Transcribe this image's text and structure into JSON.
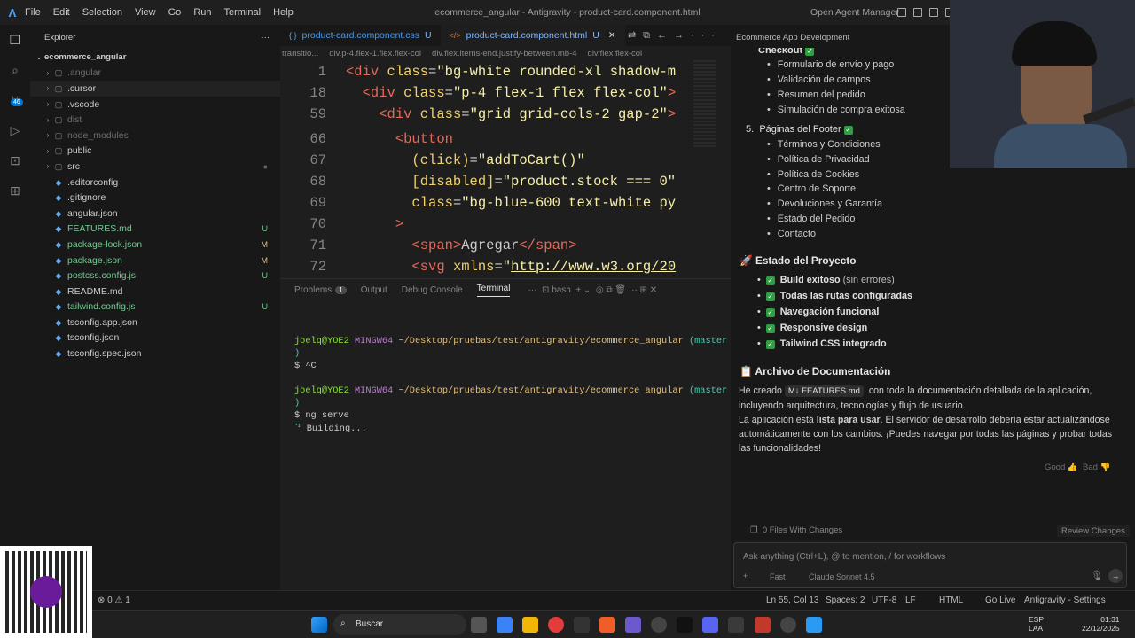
{
  "app": {
    "title": "ecommerce_angular - Antigravity - product-card.component.html",
    "agent_manager": "Open Agent Manager",
    "menu": [
      "File",
      "Edit",
      "Selection",
      "View",
      "Go",
      "Run",
      "Terminal",
      "Help"
    ]
  },
  "explorer": {
    "header": "Explorer",
    "project": "ecommerce_angular",
    "items": [
      {
        "name": ".angular",
        "type": "folder",
        "status": "",
        "tone": "dim"
      },
      {
        "name": ".cursor",
        "type": "folder",
        "status": "",
        "tone": "normal"
      },
      {
        "name": ".vscode",
        "type": "folder",
        "status": "",
        "tone": "normal"
      },
      {
        "name": "dist",
        "type": "folder",
        "status": "",
        "tone": "dim"
      },
      {
        "name": "node_modules",
        "type": "folder",
        "status": "",
        "tone": "dim"
      },
      {
        "name": "public",
        "type": "folder",
        "status": "",
        "tone": "normal"
      },
      {
        "name": "src",
        "type": "folder",
        "status": "●",
        "tone": "mod"
      },
      {
        "name": ".editorconfig",
        "type": "file",
        "status": "",
        "tone": "normal"
      },
      {
        "name": ".gitignore",
        "type": "file",
        "status": "",
        "tone": "normal"
      },
      {
        "name": "angular.json",
        "type": "file",
        "status": "",
        "tone": "normal"
      },
      {
        "name": "FEATURES.md",
        "type": "file",
        "status": "U",
        "tone": "git"
      },
      {
        "name": "package-lock.json",
        "type": "file",
        "status": "M",
        "tone": "git"
      },
      {
        "name": "package.json",
        "type": "file",
        "status": "M",
        "tone": "git"
      },
      {
        "name": "postcss.config.js",
        "type": "file",
        "status": "U",
        "tone": "git"
      },
      {
        "name": "README.md",
        "type": "file",
        "status": "",
        "tone": "normal"
      },
      {
        "name": "tailwind.config.js",
        "type": "file",
        "status": "U",
        "tone": "git"
      },
      {
        "name": "tsconfig.app.json",
        "type": "file",
        "status": "",
        "tone": "normal"
      },
      {
        "name": "tsconfig.json",
        "type": "file",
        "status": "",
        "tone": "normal"
      },
      {
        "name": "tsconfig.spec.json",
        "type": "file",
        "status": "",
        "tone": "normal"
      }
    ]
  },
  "activity_badge": "46",
  "editor": {
    "tabs": [
      {
        "label": "product-card.component.css",
        "status": "U"
      },
      {
        "label": "product-card.component.html",
        "status": "U",
        "active": true
      }
    ],
    "breadcrumbs": [
      "transitio...",
      "div.p-4.flex-1.flex.flex-col",
      "div.flex.items-end.justify-between.mb-4",
      "div.flex.flex-col"
    ],
    "lines": [
      {
        "n": "1",
        "html": "<span class='t-tag'>&lt;div</span> <span class='t-attr'>class</span>=<span class='t-str'>\"bg-white rounded-xl shadow-m</span>"
      },
      {
        "n": "18",
        "html": "  <span class='t-tag'>&lt;div</span> <span class='t-attr'>class</span>=<span class='t-str'>\"p-4 flex-1 flex flex-col\"</span><span class='t-tag'>&gt;</span>"
      },
      {
        "n": "59",
        "html": "    <span class='t-tag'>&lt;div</span> <span class='t-attr'>class</span>=<span class='t-str'>\"grid grid-cols-2 gap-2\"</span><span class='t-tag'>&gt;</span>"
      },
      {
        "n": "66",
        "html": "      <span class='t-tag'>&lt;button</span>"
      },
      {
        "n": "67",
        "html": "        <span class='t-attr'>(click)</span>=<span class='t-str'>\"addToCart()\"</span>"
      },
      {
        "n": "68",
        "html": "        <span class='t-attr'>[disabled]</span>=<span class='t-str'>\"product.stock === 0\"</span>"
      },
      {
        "n": "69",
        "html": "        <span class='t-attr'>class</span>=<span class='t-str'>\"bg-blue-600 text-white py</span>"
      },
      {
        "n": "70",
        "html": "      <span class='t-tag'>&gt;</span>"
      },
      {
        "n": "71",
        "html": "        <span class='t-tag'>&lt;span&gt;</span>Agregar<span class='t-tag'>&lt;/span&gt;</span>"
      },
      {
        "n": "72",
        "html": "        <span class='t-tag'>&lt;svg</span> <span class='t-attr'>xmlns</span>=<span class='t-str'>\"</span><span class='t-url'>http://www.w3.org/20</span>"
      }
    ]
  },
  "panel": {
    "tabs": [
      "Problems",
      "Output",
      "Debug Console",
      "Terminal"
    ],
    "problems_count": "1",
    "shell": "bash",
    "lines": [
      {
        "html": "<span class='g'>joelq@YOE2</span> <span class='p'>MINGW64</span> <span class='y'>~/Desktop/pruebas/test/antigravity/ecommerce_angular</span> <span class='cy'>(master</span>"
      },
      {
        "html": "<span class='cy'>)</span>"
      },
      {
        "html": "$ ^C"
      },
      {
        "html": ""
      },
      {
        "html": "<span class='g'>joelq@YOE2</span> <span class='p'>MINGW64</span> <span class='y'>~/Desktop/pruebas/test/antigravity/ecommerce_angular</span> <span class='cy'>(master</span>"
      },
      {
        "html": "<span class='cy'>)</span>"
      },
      {
        "html": "$ ng serve"
      },
      {
        "html": "<span class='cy'>⠙</span> Building..."
      }
    ]
  },
  "chat": {
    "title": "Ecommerce App Development",
    "checkout": "Checkout",
    "checkout_items": [
      "Formulario de envío y pago",
      "Validación de campos",
      "Resumen del pedido",
      "Simulación de compra exitosa"
    ],
    "footer_title": "Páginas del Footer",
    "footer_num": "5.",
    "footer_items": [
      "Términos y Condiciones",
      "Política de Privacidad",
      "Política de Cookies",
      "Centro de Soporte",
      "Devoluciones y Garantía",
      "Estado del Pedido",
      "Contacto"
    ],
    "estado_title": "Estado del Proyecto",
    "estado_items": [
      {
        "b": "Build exitoso",
        "n": " (sin errores)"
      },
      {
        "b": "Todas las rutas configuradas",
        "n": ""
      },
      {
        "b": "Navegación funcional",
        "n": ""
      },
      {
        "b": "Responsive design",
        "n": ""
      },
      {
        "b": "Tailwind CSS integrado",
        "n": ""
      }
    ],
    "archivo_title": "Archivo de Documentación",
    "p1a": "He creado",
    "p1chip": "FEATURES.md",
    "p1b": "con toda la documentación detallada de la aplicación,",
    "p1c": "incluyendo arquitectura, tecnologías y flujo de usuario.",
    "p2a": "La aplicación está",
    "p2b": "lista para usar",
    "p2c": ". El servidor de desarrollo debería estar actualizándose",
    "p2d": "automáticamente con los cambios. ¡Puedes navegar por todas las páginas y probar todas",
    "p2e": "las funcionalidades!",
    "good": "Good",
    "bad": "Bad",
    "files_changes": "0 Files With Changes",
    "review": "Review Changes",
    "placeholder": "Ask anything (Ctrl+L), @ to mention, / for workflows",
    "mode": "Fast",
    "model": "Claude Sonnet 4.5"
  },
  "status": {
    "problems": "⊗ 0 ⚠ 1",
    "pos": "Ln 55, Col 13",
    "spaces": "Spaces: 2",
    "enc": "UTF-8",
    "eol": "LF",
    "lang": "HTML",
    "live": "Go Live",
    "settings": "Antigravity - Settings"
  },
  "taskbar": {
    "search": "Buscar",
    "lang1": "ESP",
    "lang2": "LAA",
    "time": "01:31",
    "date": "22/12/2025"
  }
}
